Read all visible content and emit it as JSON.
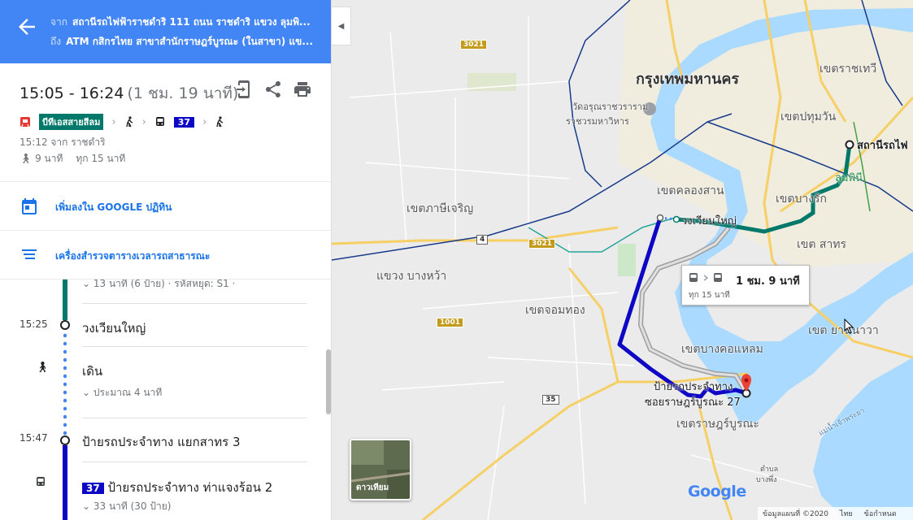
{
  "header": {
    "from_label": "จาก",
    "from_value": "สถานีรถไฟฟ้าราชดำริ 111 ถนน ราชดำริ แขวง ลุมพิ...",
    "to_label": "ถึง",
    "to_value": "ATM กสิกรไทย สาขาสำนักราษฎร์บูรณะ (ในสาขา) แข..."
  },
  "summary": {
    "time_range": "15:05 - 16:24",
    "duration": "(1 ชม. 19 นาที)",
    "bts_label": "บีทีเอสสายสีลม",
    "bus_number": "37",
    "depart": "15:12 จาก ราชดำริ",
    "walk": "9 นาที",
    "frequency": "ทุก 15 นาที"
  },
  "actions": {
    "calendar": "เพิ่มลงใน GOOGLE ปฏิทิน",
    "timetable": "เครื่องสำรวจตารางเวลารถสาธารณะ"
  },
  "steps": {
    "partial_sub": "13 นาที (6 ป้าย) · รหัสหยุด: S1 ·",
    "s1_time": "15:25",
    "s1_title": "วงเวียนใหญ่",
    "walk_title": "เดิน",
    "walk_sub": "ประมาณ 4 นาที",
    "s2_time": "15:47",
    "s2_title": "ป้ายรถประจำทาง แยกสาทร 3",
    "bus_number": "37",
    "bus_title": "ป้ายรถประจำทาง ท่าแจงร้อน 2",
    "bus_sub": "33 นาที (30 ป้าย)"
  },
  "map": {
    "tooltip_duration": "1 ชม. 9 นาที",
    "tooltip_freq": "ทุก 15 นาที",
    "satellite_label": "ดาวเทียม",
    "google_logo": "Google",
    "footer_data": "ข้อมูลแผนที่ ©2020",
    "footer_lang": "ไทย",
    "footer_terms": "ข้อกำหนด",
    "labels": {
      "bangkok": "กรุงเทพมหานคร",
      "ratchathewi": "เขตราชเทวี",
      "pathumwan": "เขตปทุมวัน",
      "wat_arun_1": "วัดอรุณราชวราราม",
      "wat_arun_2": "ราชวรมหาวิหาร",
      "ratchadamri_station": "สถานีรถไฟ",
      "lumphini": "ลุมพินี",
      "khlong_san": "เขตคลองสาน",
      "bang_rak": "เขตบางรัก",
      "wongwian_yai": "วงเวียนใหญ่",
      "phasi_charoen": "เขตภาษีเจริญ",
      "sathon": "เขต สาทร",
      "bang_wa": "แขวง บางหว้า",
      "chom_thong": "เขตจอมทอง",
      "yan_nawa": "เขต ยานนาวา",
      "bang_kho_laem": "เขตบางคอแหลม",
      "bus_stop_1": "ป้ายรถประจำทาง",
      "bus_stop_2": "ซอยราษฎร์บูรณะ 27",
      "rat_burana": "เขตราษฎร์บูรณะ",
      "river": "แม่น้ำเจ้าพระยา",
      "tambon_1": "ตำบล",
      "tambon_2": "บางพึ่ง"
    },
    "shields": {
      "r3021a": "3021",
      "r3021b": "3021",
      "r4": "4",
      "r1001": "1001",
      "r35": "35"
    }
  }
}
